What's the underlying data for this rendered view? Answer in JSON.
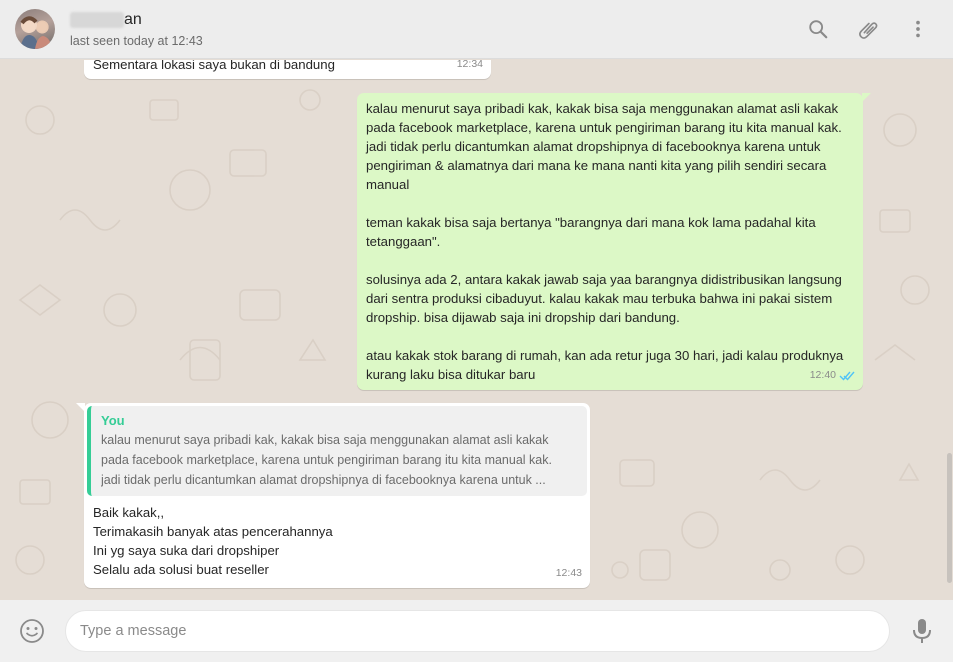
{
  "header": {
    "contact_name_visible": "an",
    "status": "last seen today at 12:43",
    "icons": [
      "search-icon",
      "attach-icon",
      "menu-icon"
    ]
  },
  "messages": [
    {
      "direction": "incoming",
      "text": "Sementara lokasi saya bukan di bandung",
      "time": "12:34"
    },
    {
      "direction": "outgoing",
      "paragraphs": [
        "kalau menurut saya pribadi kak, kakak bisa saja menggunakan alamat asli kakak pada facebook marketplace, karena untuk pengiriman barang itu kita manual kak. jadi tidak perlu dicantumkan alamat dropshipnya di facebooknya karena untuk pengiriman & alamatnya dari mana ke mana nanti kita yang pilih sendiri secara manual",
        "teman kakak bisa saja bertanya \"barangnya dari mana kok lama padahal kita tetanggaan\".",
        "solusinya ada 2, antara kakak jawab saja yaa barangnya didistribusikan langsung dari sentra produksi cibaduyut. kalau kakak mau terbuka bahwa ini pakai sistem dropship. bisa dijawab saja ini dropship dari bandung.",
        "atau kakak stok barang di rumah, kan ada retur juga 30 hari, jadi kalau produknya kurang laku bisa ditukar baru"
      ],
      "time": "12:40",
      "status_icon": "double-check-icon",
      "status_color": "#4fc3f7"
    },
    {
      "direction": "incoming",
      "quote": {
        "author": "You",
        "lines": [
          "kalau menurut saya pribadi kak, kakak bisa saja menggunakan alamat asli kakak",
          "pada facebook marketplace, karena untuk pengiriman barang itu kita manual kak.",
          "jadi tidak perlu dicantumkan alamat dropshipnya di facebooknya karena untuk ..."
        ]
      },
      "lines": [
        "Baik kakak,,",
        "Terimakasih banyak atas pencerahannya",
        "Ini yg saya suka dari dropshiper",
        "Selalu ada solusi buat reseller"
      ],
      "time": "12:43"
    }
  ],
  "composer": {
    "placeholder": "Type a message",
    "value": "",
    "icons": [
      "emoji-icon",
      "microphone-icon"
    ]
  },
  "colors": {
    "header_bg": "#ededed",
    "chat_bg": "#e5ddd5",
    "outgoing_bubble": "#dcf8c6",
    "incoming_bubble": "#ffffff",
    "quote_accent": "#35cd96"
  }
}
